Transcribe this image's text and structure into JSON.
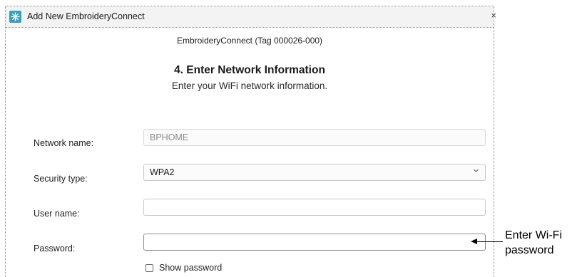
{
  "window": {
    "title": "Add New EmbroideryConnect",
    "close_glyph": "×"
  },
  "header": {
    "device_label": "EmbroideryConnect (Tag 000026-000)",
    "step_title": "4. Enter Network Information",
    "step_subtitle": "Enter your WiFi network information."
  },
  "form": {
    "network_name": {
      "label": "Network name:",
      "value": "BPHOME"
    },
    "security_type": {
      "label": "Security type:",
      "value": "WPA2"
    },
    "user_name": {
      "label": "User name:",
      "value": ""
    },
    "password": {
      "label": "Password:",
      "value": ""
    },
    "show_password": {
      "label": "Show password",
      "checked": false
    }
  },
  "callout": {
    "line1": "Enter Wi-Fi",
    "line2": "password"
  },
  "colors": {
    "app_icon": "#3aa0ba"
  }
}
